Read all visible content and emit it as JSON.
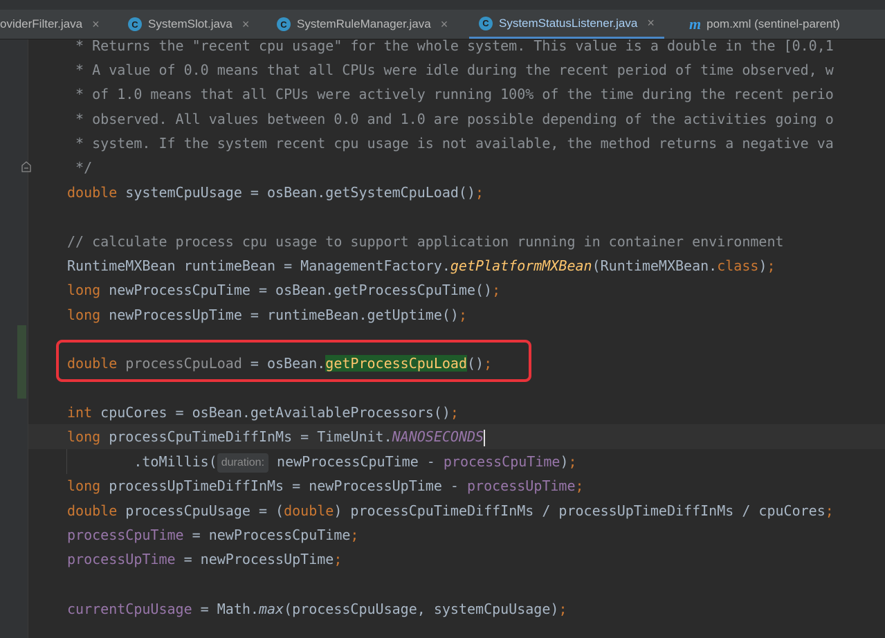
{
  "tabs": [
    {
      "label": "oviderFilter.java",
      "icon": "java-class-icon",
      "active": false
    },
    {
      "label": "SystemSlot.java",
      "icon": "java-class-icon",
      "active": false
    },
    {
      "label": "SystemRuleManager.java",
      "icon": "java-class-icon",
      "active": false
    },
    {
      "label": "SystemStatusListener.java",
      "icon": "java-class-icon",
      "active": true
    },
    {
      "label": "pom.xml (sentinel-parent)",
      "icon": "maven-icon",
      "active": false
    }
  ],
  "close_glyph": "×",
  "code": {
    "l1": " * Returns the \"recent cpu usage\" for the whole system. This value is a double in the [0.0,1",
    "l2": " * A value of 0.0 means that all CPUs were idle during the recent period of time observed, w",
    "l3": " * of 1.0 means that all CPUs were actively running 100% of the time during the recent perio",
    "l4": " * observed. All values between 0.0 and 1.0 are possible depending of the activities going o",
    "l5": " * system. If the system recent cpu usage is not available, the method returns a negative va",
    "l6": " */",
    "l7": {
      "kw": "double",
      "rest": " systemCpuUsage = osBean.getSystemCpuLoad()",
      "semi": ";"
    },
    "l8": "// calculate process cpu usage to support application running in container environment",
    "l9": {
      "a": "RuntimeMXBean runtimeBean = ManagementFactory.",
      "m": "getPlatformMXBean",
      "b": "(RuntimeMXBean.",
      "kw": "class",
      "c": ")",
      "semi": ";"
    },
    "l10": {
      "kw": "long",
      "rest": " newProcessCpuTime = osBean.getProcessCpuTime()",
      "semi": ";"
    },
    "l11": {
      "kw": "long",
      "rest": " newProcessUpTime = runtimeBean.getUptime()",
      "semi": ";"
    },
    "l12": {
      "kw": "double",
      "var": " processCpuLoad",
      "mid": " = osBean.",
      "hl": "getProcessCpuLoad",
      "end": "()",
      "semi": ";"
    },
    "l13": {
      "kw": "int",
      "rest": " cpuCores = osBean.getAvailableProcessors()",
      "semi": ";"
    },
    "l14": {
      "kw": "long",
      "rest": " processCpuTimeDiffInMs = TimeUnit.",
      "cst": "NANOSECONDS"
    },
    "l15": {
      "a": "        .toMillis(",
      "hint": "duration:",
      "b": " newProcessCpuTime - ",
      "pu": "processCpuTime",
      "c": ")",
      "semi": ";"
    },
    "l16": {
      "kw": "long",
      "rest": " processUpTimeDiffInMs = newProcessUpTime - ",
      "pu": "processUpTime",
      "semi": ";"
    },
    "l17": {
      "kw": "double",
      "a": " processCpuUsage = (",
      "kw2": "double",
      "b": ") processCpuTimeDiffInMs / processUpTimeDiffInMs / cpuCores",
      "semi": ";"
    },
    "l18": {
      "pu": "processCpuTime",
      "rest": " = newProcessCpuTime",
      "semi": ";"
    },
    "l19": {
      "pu": "processUpTime",
      "rest": " = newProcessUpTime",
      "semi": ";"
    },
    "l20": {
      "pu": "currentCpuUsage",
      "a": " = Math.",
      "m": "max",
      "b": "(processCpuUsage, systemCpuUsage)",
      "semi": ";"
    }
  }
}
